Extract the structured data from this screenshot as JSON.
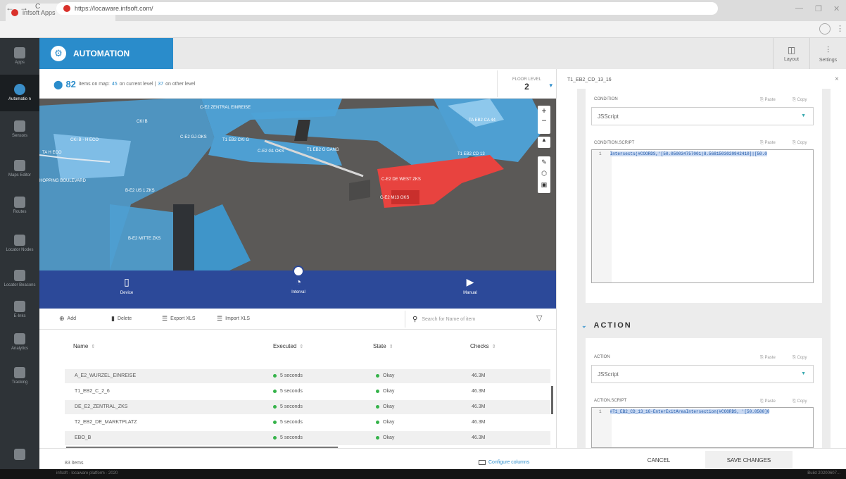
{
  "browser": {
    "tab_title": "infsoft Apps",
    "tab_close": "×",
    "new_tab": "+",
    "url": "https://locaware.infsoft.com/",
    "back": "←",
    "forward": "→",
    "reload": "C"
  },
  "rail": {
    "items": [
      {
        "label": "Apps"
      },
      {
        "label": "Automatio n"
      },
      {
        "label": "Sensors"
      },
      {
        "label": "Maps Editor"
      },
      {
        "label": "Routes"
      },
      {
        "label": "Locator Nodes"
      },
      {
        "label": "Locator Beacons"
      },
      {
        "label": "E-Inks"
      },
      {
        "label": "Analytics"
      },
      {
        "label": "Tracking"
      }
    ]
  },
  "header": {
    "app_title": "AUTOMATION",
    "layout_label": "Layout",
    "settings_label": "Settings"
  },
  "map_info": {
    "count": "82",
    "text_prefix": "items on map:",
    "current_count": "45",
    "current_text": "on current level |",
    "other_count": "37",
    "other_text": "on other level",
    "floor_label": "FLOOR LEVEL",
    "floor_value": "2"
  },
  "map": {
    "labels": [
      {
        "text": "C-E2 ZENTRAL EINREISE"
      },
      {
        "text": "CKI B"
      },
      {
        "text": "CKI B - H ECO"
      },
      {
        "text": "C-E2 GJ-OKS"
      },
      {
        "text": "T1 EB2 CKI G"
      },
      {
        "text": "C-E2 G1 OKS"
      },
      {
        "text": "T1 EB2 G GANG"
      },
      {
        "text": "TA EB2 CA 44"
      },
      {
        "text": "TA H ECO"
      },
      {
        "text": "T1 EB2 CD 13"
      },
      {
        "text": "HOPPING BOULEVARD"
      },
      {
        "text": "B-E2 US 1 ZKS"
      },
      {
        "text": "C-E2 DE WEST ZKS"
      },
      {
        "text": "C-E2 M13 OKS"
      },
      {
        "text": "B-E2 MITTE ZKS"
      }
    ],
    "zoom_in": "+",
    "zoom_out": "−"
  },
  "modes": [
    {
      "label": "Device",
      "icon": "phone-icon"
    },
    {
      "label": "Interval",
      "icon": "timer-icon"
    },
    {
      "label": "Manual",
      "icon": "play-icon"
    }
  ],
  "toolbar": {
    "add": "Add",
    "delete": "Delete",
    "export": "Export XLS",
    "import": "Import XLS",
    "search_placeholder": "Search for Name of item"
  },
  "table": {
    "columns": [
      "Name",
      "Executed",
      "State",
      "Checks"
    ],
    "rows": [
      {
        "name": "A_E2_WURZEL_EINREISE",
        "executed": "5 seconds",
        "state": "Okay",
        "checks": "46.3M"
      },
      {
        "name": "T1_EB2_C_2_6",
        "executed": "5 seconds",
        "state": "Okay",
        "checks": "46.3M"
      },
      {
        "name": "DE_E2_ZENTRAL_ZKS",
        "executed": "5 seconds",
        "state": "Okay",
        "checks": "46.3M"
      },
      {
        "name": "T2_EB2_DE_MARKTPLATZ",
        "executed": "5 seconds",
        "state": "Okay",
        "checks": "46.3M"
      },
      {
        "name": "EBO_B",
        "executed": "5 seconds",
        "state": "Okay",
        "checks": "46.3M"
      }
    ],
    "items_count": "83 items",
    "configure": "Configure columns"
  },
  "status": {
    "left": "infsoft - locaware platform - 2020",
    "right": "Build 20200607..."
  },
  "panel": {
    "title": "T1_EB2_CD_13_16",
    "close": "×",
    "paste": "Paste",
    "copy": "Copy",
    "condition_label": "CONDITION",
    "condition_value": "JSScript",
    "condition_script_label": "CONDITION.SCRIPT",
    "condition_code_line": "1",
    "condition_code": "Intersects(#COORDS,'[50.050034757001|8.5681503020942410]|[50.0",
    "action_section": "ACTION",
    "action_label": "ACTION",
    "action_value": "JSScript",
    "action_script_label": "ACTION.SCRIPT",
    "action_code_line": "1",
    "action_code": "#T1_EB2_CD_13_16-EnterExitAreaIntersection(#COORDS, '[50.0500]0",
    "cancel": "CANCEL",
    "save": "SAVE CHANGES"
  },
  "colors": {
    "brand": "#2a8ccb",
    "modebar": "#2c4999",
    "zone": "#5ba8d8",
    "alert_zone": "#e8433f",
    "ok": "#35b34a"
  }
}
